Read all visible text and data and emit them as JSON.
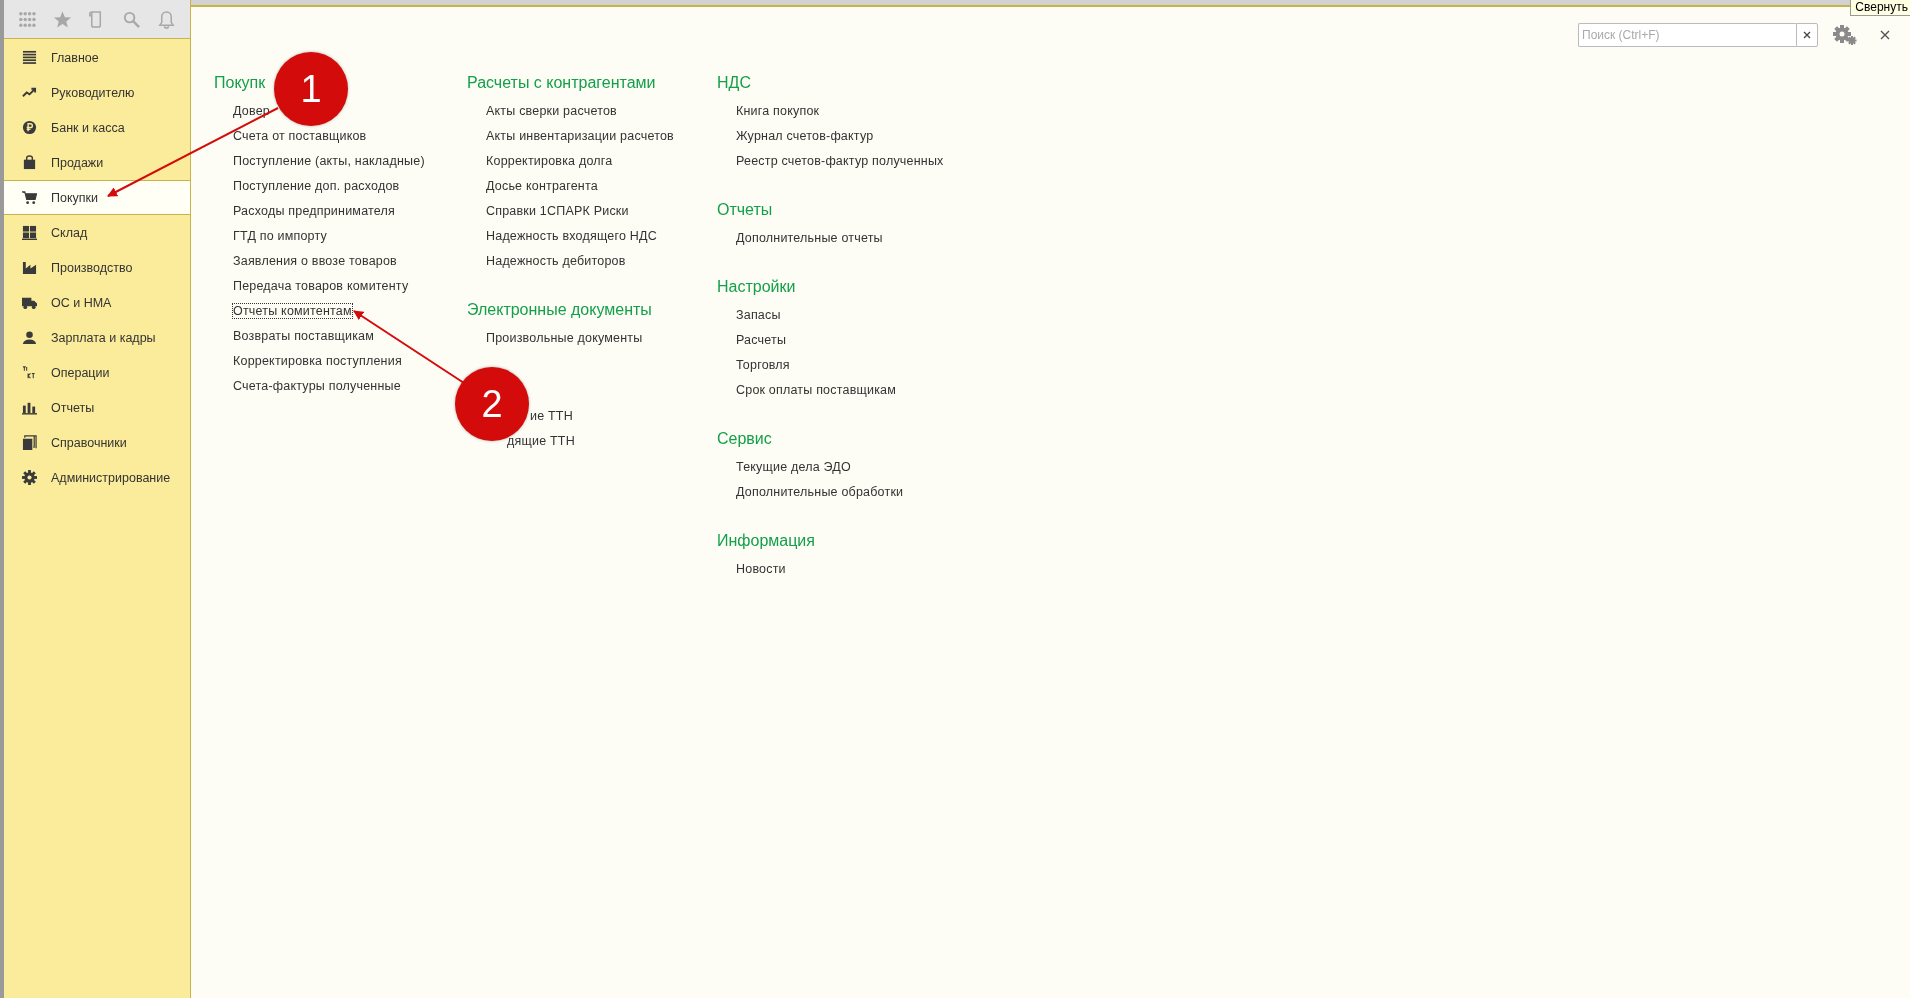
{
  "toolbar_icons": [
    {
      "kind": "grid"
    },
    {
      "kind": "star"
    },
    {
      "kind": "history"
    },
    {
      "kind": "search"
    },
    {
      "kind": "bell"
    }
  ],
  "sidebar": {
    "items": [
      {
        "label": "Главное",
        "selected": false
      },
      {
        "label": "Руководителю",
        "selected": false
      },
      {
        "label": "Банк и касса",
        "selected": false
      },
      {
        "label": "Продажи",
        "selected": false
      },
      {
        "label": "Покупки",
        "selected": true
      },
      {
        "label": "Склад",
        "selected": false
      },
      {
        "label": "Производство",
        "selected": false
      },
      {
        "label": "ОС и НМА",
        "selected": false
      },
      {
        "label": "Зарплата и кадры",
        "selected": false
      },
      {
        "label": "Операции",
        "selected": false
      },
      {
        "label": "Отчеты",
        "selected": false
      },
      {
        "label": "Справочники",
        "selected": false
      },
      {
        "label": "Администрирование",
        "selected": false
      }
    ]
  },
  "search": {
    "placeholder": "Поиск (Ctrl+F)"
  },
  "tooltip": {
    "text": "Свернуть"
  },
  "columns": [
    [
      {
        "title": "Покупк",
        "items": [
          {
            "label": "Довер",
            "focused": false
          },
          {
            "label": "Счета от поставщиков",
            "focused": false
          },
          {
            "label": "Поступление (акты, накладные)",
            "focused": false
          },
          {
            "label": "Поступление доп. расходов",
            "focused": false
          },
          {
            "label": "Расходы предпринимателя",
            "focused": false
          },
          {
            "label": "ГТД по импорту",
            "focused": false
          },
          {
            "label": "Заявления о ввозе товаров",
            "focused": false
          },
          {
            "label": "Передача товаров комитенту",
            "focused": false
          },
          {
            "label": "Отчеты комитентам",
            "focused": true
          },
          {
            "label": "Возвраты поставщикам",
            "focused": false
          },
          {
            "label": "Корректировка поступления",
            "focused": false
          },
          {
            "label": "Счета-фактуры полученные",
            "focused": false
          }
        ]
      }
    ],
    [
      {
        "title": "Расчеты с контрагентами",
        "items": [
          {
            "label": "Акты сверки расчетов",
            "focused": false
          },
          {
            "label": "Акты инвентаризации расчетов",
            "focused": false
          },
          {
            "label": "Корректировка долга",
            "focused": false
          },
          {
            "label": "Досье контрагента",
            "focused": false
          },
          {
            "label": "Справки 1СПАРК Риски",
            "focused": false
          },
          {
            "label": "Надежность входящего НДС",
            "focused": false
          },
          {
            "label": "Надежность дебиторов",
            "focused": false
          }
        ]
      },
      {
        "title": "Электронные документы",
        "items": [
          {
            "label": "Произвольные документы",
            "focused": false
          }
        ]
      },
      {
        "items": [
          {
            "label": "ие ТТН",
            "focused": false
          },
          {
            "label": "дящие ТТН",
            "focused": false
          }
        ]
      }
    ],
    [
      {
        "title": "НДС",
        "items": [
          {
            "label": "Книга покупок",
            "focused": false
          },
          {
            "label": "Журнал счетов-фактур",
            "focused": false
          },
          {
            "label": "Реестр счетов-фактур полученных",
            "focused": false
          }
        ]
      },
      {
        "title": "Отчеты",
        "items": [
          {
            "label": "Дополнительные отчеты",
            "focused": false
          }
        ]
      },
      {
        "title": "Настройки",
        "items": [
          {
            "label": "Запасы",
            "focused": false
          },
          {
            "label": "Расчеты",
            "focused": false
          },
          {
            "label": "Торговля",
            "focused": false
          },
          {
            "label": "Срок оплаты поставщикам",
            "focused": false
          }
        ]
      },
      {
        "title": "Сервис",
        "items": [
          {
            "label": "Текущие дела ЭДО",
            "focused": false
          },
          {
            "label": "Дополнительные обработки",
            "focused": false
          }
        ]
      },
      {
        "title": "Информация",
        "items": [
          {
            "label": "Новости",
            "focused": false
          }
        ]
      }
    ]
  ],
  "callouts": [
    {
      "number": "1"
    },
    {
      "number": "2"
    }
  ]
}
